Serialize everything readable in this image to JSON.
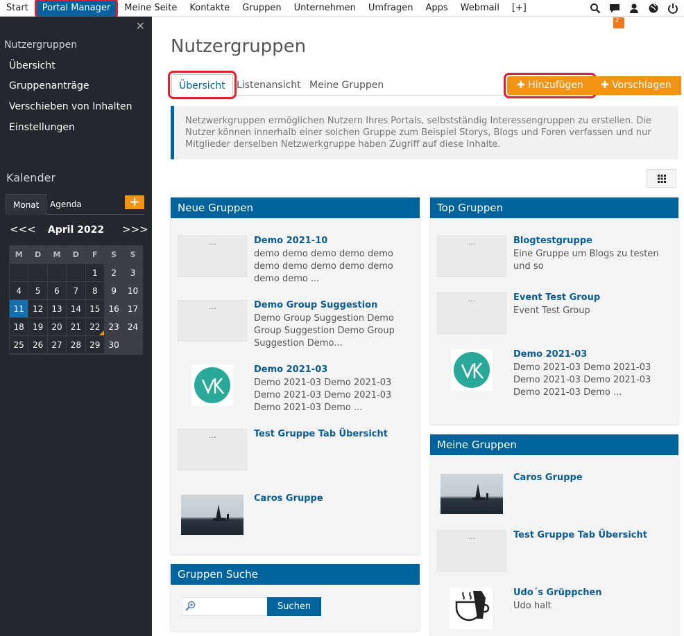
{
  "topnav": {
    "items": [
      "Start",
      "Portal Manager",
      "Meine Seite",
      "Kontakte",
      "Gruppen",
      "Unternehmen",
      "Umfragen",
      "Apps",
      "Webmail",
      "[+]"
    ],
    "active_index": 1,
    "icons": [
      "search-icon",
      "chat-icon",
      "user-icon",
      "globe-icon",
      "power-icon"
    ],
    "chat_badge": "2"
  },
  "sidebar": {
    "section_title": "Nutzergruppen",
    "items": [
      "Übersicht",
      "Gruppenanträge",
      "Verschieben von Inhalten",
      "Einstellungen"
    ],
    "calendar": {
      "title": "Kalender",
      "tabs": [
        "Monat",
        "Agenda"
      ],
      "month": "April 2022",
      "prev": "<<<",
      "next": ">>>",
      "weekdays": [
        "M",
        "D",
        "M",
        "D",
        "F",
        "S",
        "S"
      ],
      "days": [
        "",
        "",
        "",
        "",
        "1",
        "2",
        "3",
        "4",
        "5",
        "6",
        "7",
        "8",
        "9",
        "10",
        "11",
        "12",
        "13",
        "14",
        "15",
        "16",
        "17",
        "18",
        "19",
        "20",
        "21",
        "22",
        "23",
        "24",
        "25",
        "26",
        "27",
        "28",
        "29",
        "30",
        ""
      ],
      "today": "11",
      "marked": "22"
    }
  },
  "main": {
    "title": "Nutzergruppen",
    "tabs": [
      "Übersicht",
      "Listenansicht",
      "Meine Gruppen"
    ],
    "add_button": "Hinzufügen",
    "suggest_button": "Vorschlagen",
    "info": "Netzwerkgruppen ermöglichen Nutzern Ihres Portals, selbstständig Interessengruppen zu erstellen. Die Nutzer können innerhalb einer solchen Gruppe zum Beispiel Storys, Blogs und Foren verfassen und nur Mitglieder derselben Netzwerkgruppe haben Zugriff auf diese Inhalte."
  },
  "panels": {
    "neue": {
      "title": "Neue Gruppen",
      "entries": [
        {
          "title": "Demo 2021-10",
          "desc": "demo demo demo demo demo demo demo demo demo demo demo demo ...",
          "thumb": "..."
        },
        {
          "title": "Demo Group Suggestion",
          "desc": "Demo Group Suggestion Demo Group Suggestion Demo Group Suggestion Demo...",
          "thumb": "..."
        },
        {
          "title": "Demo 2021-03",
          "desc": "Demo 2021-03 Demo 2021-03 Demo 2021-03 Demo 2021-03 Demo 2021-03 Demo ...",
          "thumb": "VK"
        },
        {
          "title": "Test Gruppe Tab Übersicht",
          "desc": "",
          "thumb": "..."
        },
        {
          "title": "Caros Gruppe",
          "desc": "",
          "thumb": ""
        }
      ]
    },
    "top": {
      "title": "Top Gruppen",
      "entries": [
        {
          "title": "Blogtestgruppe",
          "desc": "Eine Gruppe um Blogs zu testen und so",
          "thumb": "..."
        },
        {
          "title": "Event Test Group",
          "desc": "Event Test Group",
          "thumb": "..."
        },
        {
          "title": "Demo 2021-03",
          "desc": "Demo 2021-03 Demo 2021-03 Demo 2021-03 Demo 2021-03 Demo 2021-03 Demo ...",
          "thumb": "VK"
        }
      ]
    },
    "meine": {
      "title": "Meine Gruppen",
      "entries": [
        {
          "title": "Caros Gruppe",
          "desc": "",
          "thumb": ""
        },
        {
          "title": "Test Gruppe Tab Übersicht",
          "desc": "",
          "thumb": "..."
        },
        {
          "title": "Udo´s Grüppchen",
          "desc": "Udo halt",
          "thumb": "COFFEE"
        }
      ]
    },
    "suche": {
      "title": "Gruppen Suche",
      "button": "Suchen"
    }
  }
}
